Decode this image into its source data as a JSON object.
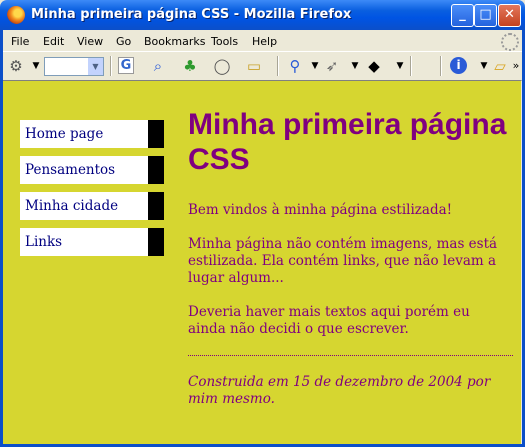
{
  "window": {
    "title": "Minha primeira página CSS - Mozilla Firefox"
  },
  "menu": [
    "File",
    "Edit",
    "View",
    "Go",
    "Bookmarks",
    "Tools",
    "Help"
  ],
  "toolbar_icons": [
    "google-icon",
    "search-icon",
    "clover-icon",
    "speech-bubble-icon",
    "book-icon",
    "zoom-icon",
    "mouse-icon",
    "graduation-cap-icon",
    "info-icon",
    "folder-icon"
  ],
  "page": {
    "nav": [
      "Home page",
      "Pensamentos",
      "Minha cidade",
      "Links"
    ],
    "heading": "Minha primeira página CSS",
    "paragraphs": [
      "Bem vindos à minha página estilizada!",
      "Minha página não contém imagens, mas está estilizada. Ela contém links, que não levam a lugar algum...",
      "Deveria haver mais textos aqui porém eu ainda não decidi o que escrever."
    ],
    "address": "Construida em 15 de dezembro de 2004 por mim mesmo."
  },
  "colors": {
    "background": "#d6d630",
    "text": "#800080",
    "link": "#000080"
  }
}
